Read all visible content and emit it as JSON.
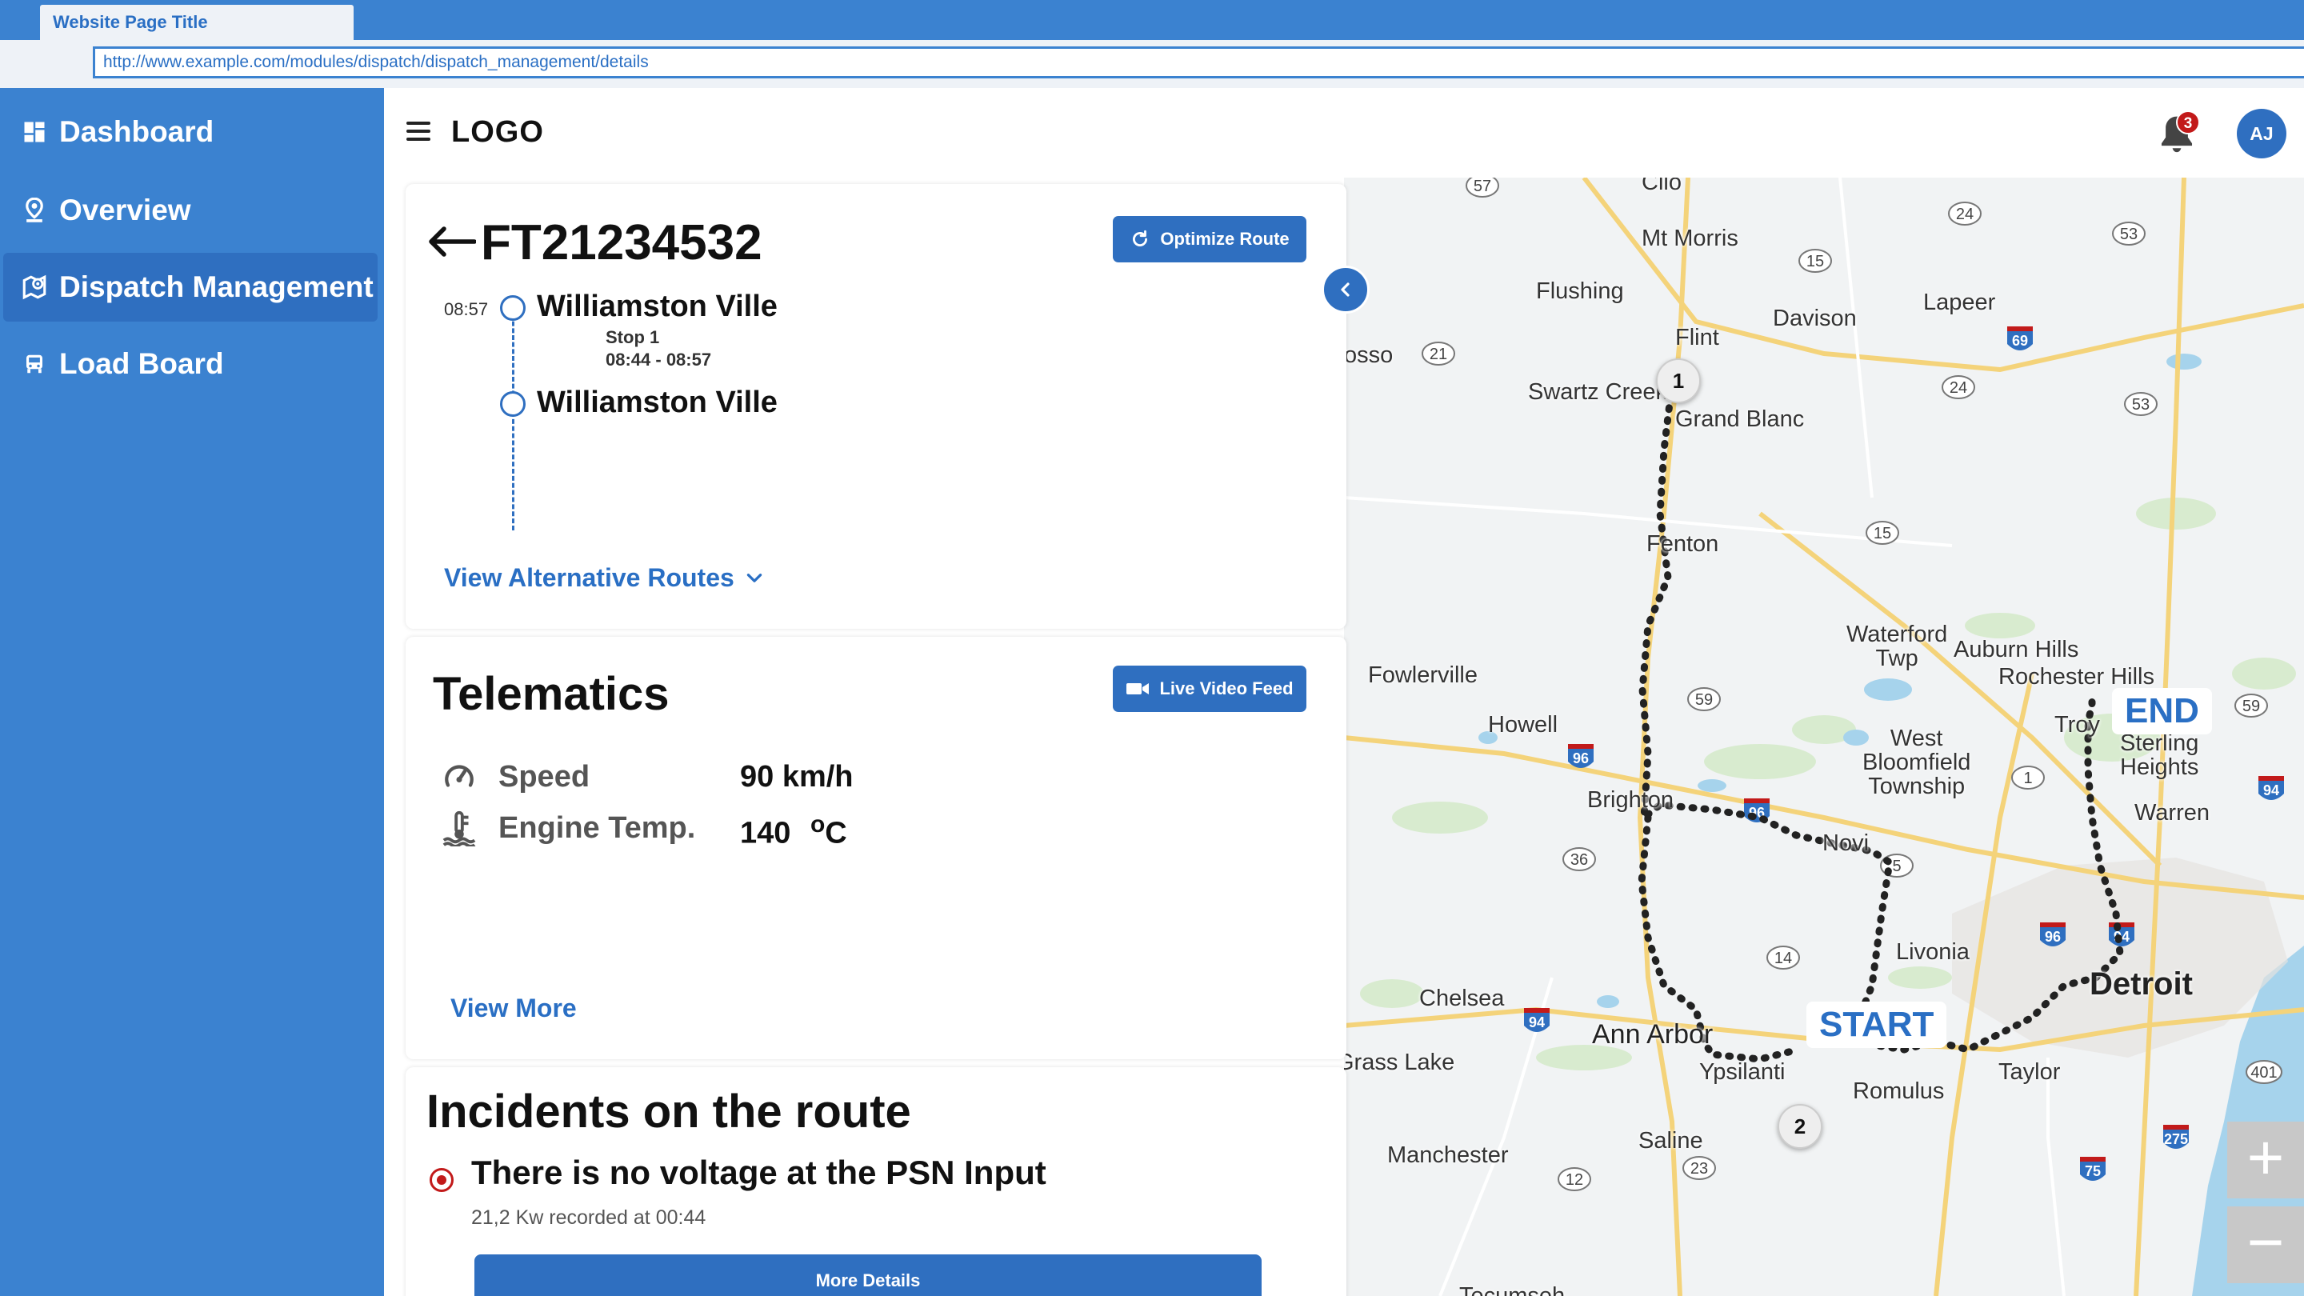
{
  "browser": {
    "tab_title": "Website Page Title",
    "url": "http://www.example.com/modules/dispatch/dispatch_management/details"
  },
  "sidebar": {
    "items": [
      {
        "label": "Dashboard",
        "icon": "dashboard-icon"
      },
      {
        "label": "Overview",
        "icon": "location-pin-icon"
      },
      {
        "label": "Dispatch Management",
        "icon": "map-pin-icon",
        "active": true
      },
      {
        "label": "Load Board",
        "icon": "truck-icon"
      }
    ]
  },
  "header": {
    "logo": "LOGO",
    "notification_count": "3",
    "avatar_initials": "AJ"
  },
  "route": {
    "id": "FT21234532",
    "optimize_label": "Optimize Route",
    "stops": [
      {
        "time": "08:57",
        "name": "Williamston Ville",
        "stop_label": "Stop 1",
        "window": "08:44 - 08:57"
      },
      {
        "time": "",
        "name": "Williamston Ville",
        "stop_label": "",
        "window": ""
      }
    ],
    "alt_routes_label": "View Alternative Routes"
  },
  "telematics": {
    "title": "Telematics",
    "live_feed_label": "Live Video Feed",
    "speed_label": "Speed",
    "speed_value": "90 km/h",
    "temp_label": "Engine Temp.",
    "temp_value": "140",
    "temp_unit_deg": "o",
    "temp_unit": "C",
    "view_more_label": "View More"
  },
  "incidents": {
    "title": "Incidents on the route",
    "items": [
      {
        "text": "There is no voltage at the PSN Input",
        "detail": "21,2 Kw recorded at 00:44"
      }
    ],
    "more_details_label": "More Details"
  },
  "map": {
    "start_label": "START",
    "end_label": "END",
    "waypoint_1": "1",
    "waypoint_2": "2",
    "zoom_in": "+",
    "zoom_out": "−",
    "places": {
      "clio": "Clio",
      "mt_morris": "Mt Morris",
      "flushing": "Flushing",
      "davison": "Davison",
      "lapeer": "Lapeer",
      "flint": "Flint",
      "osso": "osso",
      "swartz_creek": "Swartz Creek",
      "grand_blanc": "Grand Blanc",
      "fenton": "Fenton",
      "waterford": "Waterford\nTwp",
      "auburn_hills": "Auburn Hills",
      "rochester_hills": "Rochester Hills",
      "fowlerville": "Fowlerville",
      "howell": "Howell",
      "west_bloomfield": "West\nBloomfield\nTownship",
      "troy": "Troy",
      "sterling_heights": "Sterling\nHeights",
      "brighton": "Brighton",
      "novi": "Novi",
      "warren": "Warren",
      "livonia": "Livonia",
      "detroit": "Detroit",
      "chelsea": "Chelsea",
      "ann_arbor": "Ann Arbor",
      "ypsilanti": "Ypsilanti",
      "romulus": "Romulus",
      "taylor": "Taylor",
      "grass_lake": "Grass Lake",
      "saline": "Saline",
      "manchester": "Manchester",
      "tecumseh": "Tecumseh"
    }
  },
  "colors": {
    "brand_blue": "#3b82d0",
    "active_blue": "#2f6fc0",
    "alert_red": "#c21a1a"
  }
}
